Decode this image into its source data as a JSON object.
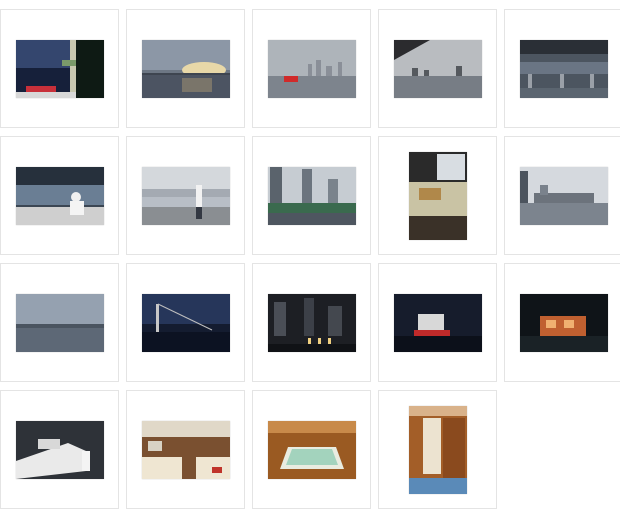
{
  "gallery": {
    "thumbnails": [
      {
        "scene": "night-deck-bridge",
        "orientation": "landscape"
      },
      {
        "scene": "bay-sunset",
        "orientation": "landscape"
      },
      {
        "scene": "skyline-red-boat",
        "orientation": "landscape"
      },
      {
        "scene": "skyline-under-bridge",
        "orientation": "landscape"
      },
      {
        "scene": "bridge-underside",
        "orientation": "landscape"
      },
      {
        "scene": "captain-deck",
        "orientation": "landscape"
      },
      {
        "scene": "woman-deck",
        "orientation": "landscape"
      },
      {
        "scene": "towers-promenade",
        "orientation": "landscape"
      },
      {
        "scene": "interior-window",
        "orientation": "portrait"
      },
      {
        "scene": "harbor-buildings",
        "orientation": "landscape"
      },
      {
        "scene": "misty-bay",
        "orientation": "landscape"
      },
      {
        "scene": "night-bridge",
        "orientation": "landscape"
      },
      {
        "scene": "night-towers",
        "orientation": "landscape"
      },
      {
        "scene": "night-ship",
        "orientation": "landscape"
      },
      {
        "scene": "night-cabin-glow",
        "orientation": "landscape"
      },
      {
        "scene": "boat-bow-man",
        "orientation": "landscape"
      },
      {
        "scene": "salon-interior",
        "orientation": "landscape"
      },
      {
        "scene": "cabin-bed",
        "orientation": "landscape"
      },
      {
        "scene": "cabin-door",
        "orientation": "portrait"
      }
    ]
  }
}
